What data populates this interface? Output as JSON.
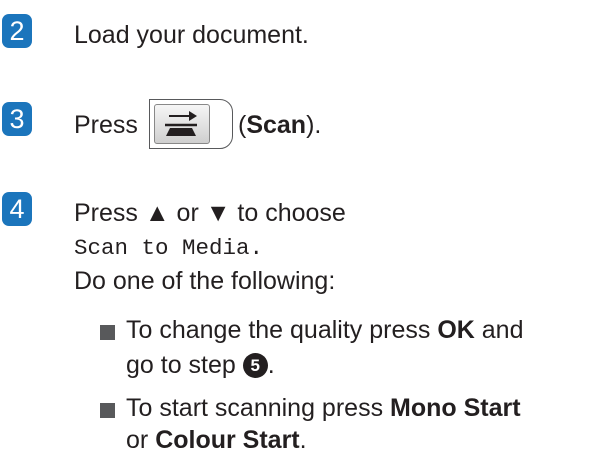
{
  "steps": [
    {
      "number": "2",
      "text": "Load your document."
    },
    {
      "number": "3",
      "press": "Press",
      "paren_open": "(",
      "scan": "Scan",
      "paren_close": ")."
    },
    {
      "number": "4",
      "line1": "Press ▲ or ▼ to choose",
      "menu_item": "Scan to Media.",
      "line3": "Do one of the following:"
    }
  ],
  "bullets": [
    {
      "pre": "To change the quality press ",
      "key": "OK",
      "post": " and",
      "line2_pre": "go to step ",
      "step_ref": "5",
      "line2_post": "."
    },
    {
      "pre": "To start scanning press ",
      "key": "Mono Start",
      "line2_pre": "or ",
      "key2": "Colour Start",
      "line2_post": "."
    }
  ],
  "icons": {
    "scan_button": "scan-icon"
  },
  "colors": {
    "step_badge": "#1b75bc",
    "bullet": "#58595b",
    "text": "#231f20"
  }
}
